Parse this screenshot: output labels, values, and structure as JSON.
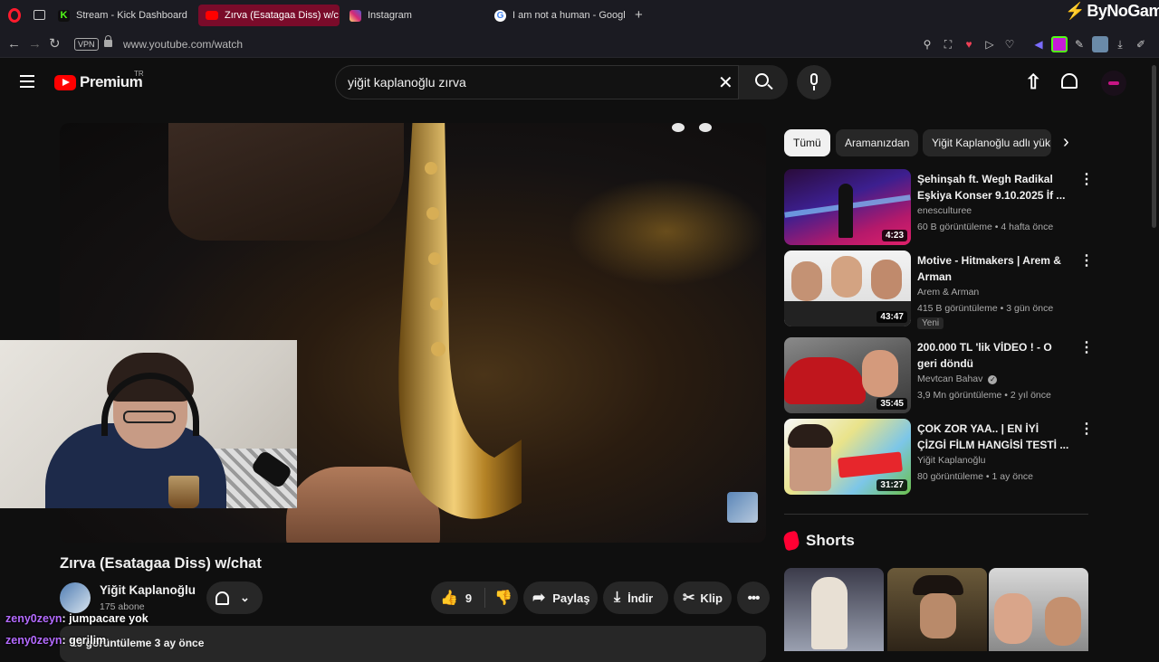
{
  "browser": {
    "tabs": [
      {
        "label": "Stream - Kick Dashboard",
        "color": "#53fc18"
      },
      {
        "label": "Zırva (Esatagaa Diss) w/c",
        "color": "#ff0000"
      },
      {
        "label": "Instagram",
        "color": "#d6249f"
      },
      {
        "label": "I am not a human - Googl",
        "color": "#4285f4"
      }
    ],
    "new_tab": "+",
    "url": "www.youtube.com/watch",
    "vpn_badge": "VPN",
    "watermark": "ByNoGame"
  },
  "youtube": {
    "logo_text": "Premium",
    "region": "TR",
    "search_value": "yiğit kaplanoğlu zırva"
  },
  "video": {
    "title": "Zırva (Esatagaa Diss) w/chat",
    "channel": "Yiğit Kaplanoğlu",
    "subscribers": "175 abone",
    "likes": "9",
    "share_label": "Paylaş",
    "download_label": "İndir",
    "clip_label": "Klip",
    "views_date": "19 görüntüleme  3 ay önce"
  },
  "chat": [
    {
      "user": "zeny0zeyn",
      "message": ": jumpacare yok"
    },
    {
      "user": "zeny0zeyn",
      "message": ": gerilim"
    }
  ],
  "sidebar": {
    "chips": [
      "Tümü",
      "Aramanızdan",
      "Yiğit Kaplanoğlu adlı yük"
    ],
    "recommendations": [
      {
        "title": "Şehinşah ft. Wegh Radikal Eşkiya Konser 9.10.2025 İf ...",
        "channel": "enesculturee",
        "stats": "60 B görüntüleme • 4 hafta önce",
        "duration": "4:23",
        "badge": ""
      },
      {
        "title": "Motive - Hitmakers | Arem & Arman",
        "channel": "Arem & Arman",
        "stats": "415 B görüntüleme • 3 gün önce",
        "duration": "43:47",
        "badge": "Yeni"
      },
      {
        "title": "200.000 TL 'lik VİDEO ! - O geri döndü",
        "channel": "Mevtcan Bahav",
        "stats": "3,9 Mn görüntüleme • 2 yıl önce",
        "duration": "35:45",
        "badge": ""
      },
      {
        "title": "ÇOK ZOR YAA.. | EN İYİ ÇİZGİ FİLM HANGİSİ TESTİ ...",
        "channel": "Yiğit Kaplanoğlu",
        "stats": "80 görüntüleme • 1 ay önce",
        "duration": "31:27",
        "badge": ""
      }
    ],
    "shorts_title": "Shorts"
  }
}
